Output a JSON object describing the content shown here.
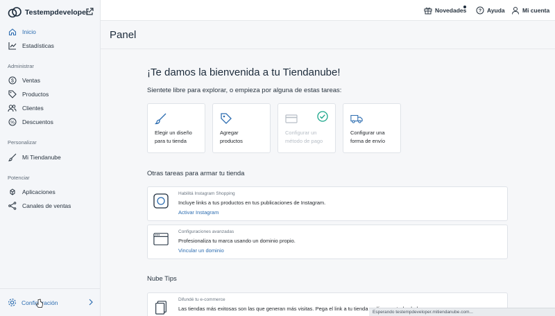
{
  "sidebar": {
    "store_name": "Testempdeveloper",
    "nav_top": [
      {
        "label": "Inicio",
        "icon": "home-icon",
        "active": true
      },
      {
        "label": "Estadísticas",
        "icon": "chart-icon",
        "active": false
      }
    ],
    "sections": [
      {
        "title": "Administrar",
        "items": [
          {
            "label": "Ventas",
            "icon": "dollar-icon"
          },
          {
            "label": "Productos",
            "icon": "tag-icon"
          },
          {
            "label": "Clientes",
            "icon": "users-icon"
          },
          {
            "label": "Descuentos",
            "icon": "percent-icon"
          }
        ]
      },
      {
        "title": "Personalizar",
        "items": [
          {
            "label": "Mi Tiendanube",
            "icon": "brush-icon"
          }
        ]
      },
      {
        "title": "Potenciar",
        "items": [
          {
            "label": "Aplicaciones",
            "icon": "apps-icon"
          },
          {
            "label": "Canales de ventas",
            "icon": "network-icon"
          }
        ]
      }
    ],
    "config_label": "Configuración"
  },
  "topbar": {
    "novedades": "Novedades",
    "ayuda": "Ayuda",
    "cuenta": "Mi cuenta"
  },
  "main": {
    "page_title": "Panel",
    "welcome": "¡Te damos la bienvenida a tu Tiendanube!",
    "subtitle": "Sientete libre para explorar, o empieza por alguna de estas tareas:",
    "tasks": [
      {
        "line1": "Elegir un diseño",
        "line2": "para tu tienda",
        "icon": "brush-icon",
        "done": false
      },
      {
        "line1": "Agregar",
        "line2": "productos",
        "icon": "tag-icon",
        "done": false
      },
      {
        "line1": "Configurar un",
        "line2": "método de pago",
        "icon": "credit-card-icon",
        "done": true
      },
      {
        "line1": "Configurar una",
        "line2": "forma de envío",
        "icon": "truck-icon",
        "done": false
      }
    ],
    "other_tasks_title": "Otras tareas para armar tu tienda",
    "cards": [
      {
        "eyebrow": "Habilitá Instagram Shopping",
        "text": "Incluye links a tus productos en tus publicaciones de Instagram.",
        "link": "Activar Instagram",
        "icon": "instagram-icon"
      },
      {
        "eyebrow": "Configuraciones avanzadas",
        "text": "Profesionaliza tu marca usando un dominio propio.",
        "link": "Vincular un dominio",
        "icon": "browser-icon"
      }
    ],
    "tips_title": "Nube Tips",
    "tip": {
      "eyebrow": "Difundé tu e-commerce",
      "text": "Las tiendas más exitosas son las que generan más visitas. Pega el link a tu tienda en línea en todas lados",
      "icon": "documents-icon"
    }
  },
  "status_bar": "Esperando testempdeveloper.mitiendanube.com...",
  "colors": {
    "accent": "#2b6cb0",
    "check": "#17a589"
  }
}
